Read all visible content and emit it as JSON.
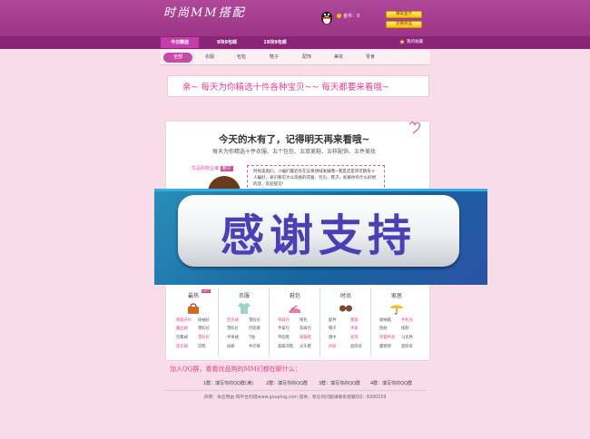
{
  "header": {
    "logo": "时尚MM搭配",
    "coins_label": "金币：0",
    "btn_earn": "赚取金币",
    "btn_redeem": "兑换商品"
  },
  "nav": {
    "tabs": [
      "今日精选",
      "9块9包邮",
      "19块9包邮"
    ],
    "favorite": "我的收藏"
  },
  "subnav": [
    "全部",
    "衣服",
    "包包",
    "鞋子",
    "配饰",
    "美妆",
    "零食"
  ],
  "banner": "亲~ 每天为你精选十件各种宝贝~~ 每天都要来看哦~",
  "empty": {
    "title": "今天的木有了，记得明天再来看哦~",
    "subtitle": "每天为你精选十件衣服、五个包包、五双美鞋、五样配饰、五件美妆",
    "guide_prefix": "优品购物主编",
    "guide_badge": "楠子",
    "bubble_text": "时尚美眉们，小编们最近有在这将领域发展哦~我是还是哥可欧有十人编好，表们要可大么风格的衣服、包包、鞋子，如果你有什么好想的话，欢迎提交！"
  },
  "overlay": {
    "text": "感谢支持"
  },
  "categories": [
    {
      "title": "最热",
      "hot": "HOT",
      "links": [
        [
          "韩版开衫",
          "短袖衫"
        ],
        [
          "蕾丝裙",
          "雪纺衫"
        ],
        [
          "包臀裙",
          "雪纺衫"
        ],
        [
          "连衣裙",
          "凉鞋"
        ]
      ]
    },
    {
      "title": "衣服",
      "links": [
        [
          "连衣裙",
          "雪纺衫"
        ],
        [
          "雪纺衫",
          "打底裤"
        ],
        [
          "半身裙",
          "T恤"
        ],
        [
          "短裤",
          "牛仔裤"
        ]
      ]
    },
    {
      "title": "鞋包",
      "links": [
        [
          "单肩包",
          "钱包"
        ],
        [
          "手拿包",
          "双肩包"
        ],
        [
          "平底鞋",
          "坡跟鞋"
        ],
        [
          "高跟凉鞋",
          "尖头鞋"
        ]
      ]
    },
    {
      "title": "时尚",
      "links": [
        [
          "配件",
          "墨镜"
        ],
        [
          "帽子",
          "手表"
        ],
        [
          "围巾",
          "发饰"
        ],
        [
          "护肤",
          "遮阳伞"
        ]
      ]
    },
    {
      "title": "家居",
      "links": [
        [
          "收纳箱",
          "手机壳"
        ],
        [
          "抱枕",
          "拖鞋"
        ],
        [
          "创意杯具",
          "马克杯"
        ],
        [
          "置物架",
          "遮阳伞"
        ]
      ]
    }
  ],
  "qq": {
    "title": "加入QQ群，看看优品购的MM们都在聊什么：",
    "items": [
      "1群：填写你的QQ群(满)",
      "2群：填写你的QQ群",
      "3群：填写你的QQ群",
      "4群：填写你的QQ群"
    ]
  },
  "footer": "声明：本应用由 购平台利得www.gouping.com 提供，有任何问题请联系客服QQ：8200159",
  "colors": {
    "header": "#9c3585",
    "accent": "#e33e8c",
    "overlay": "#1665a0",
    "overlay_text": "#4a3fb5"
  }
}
